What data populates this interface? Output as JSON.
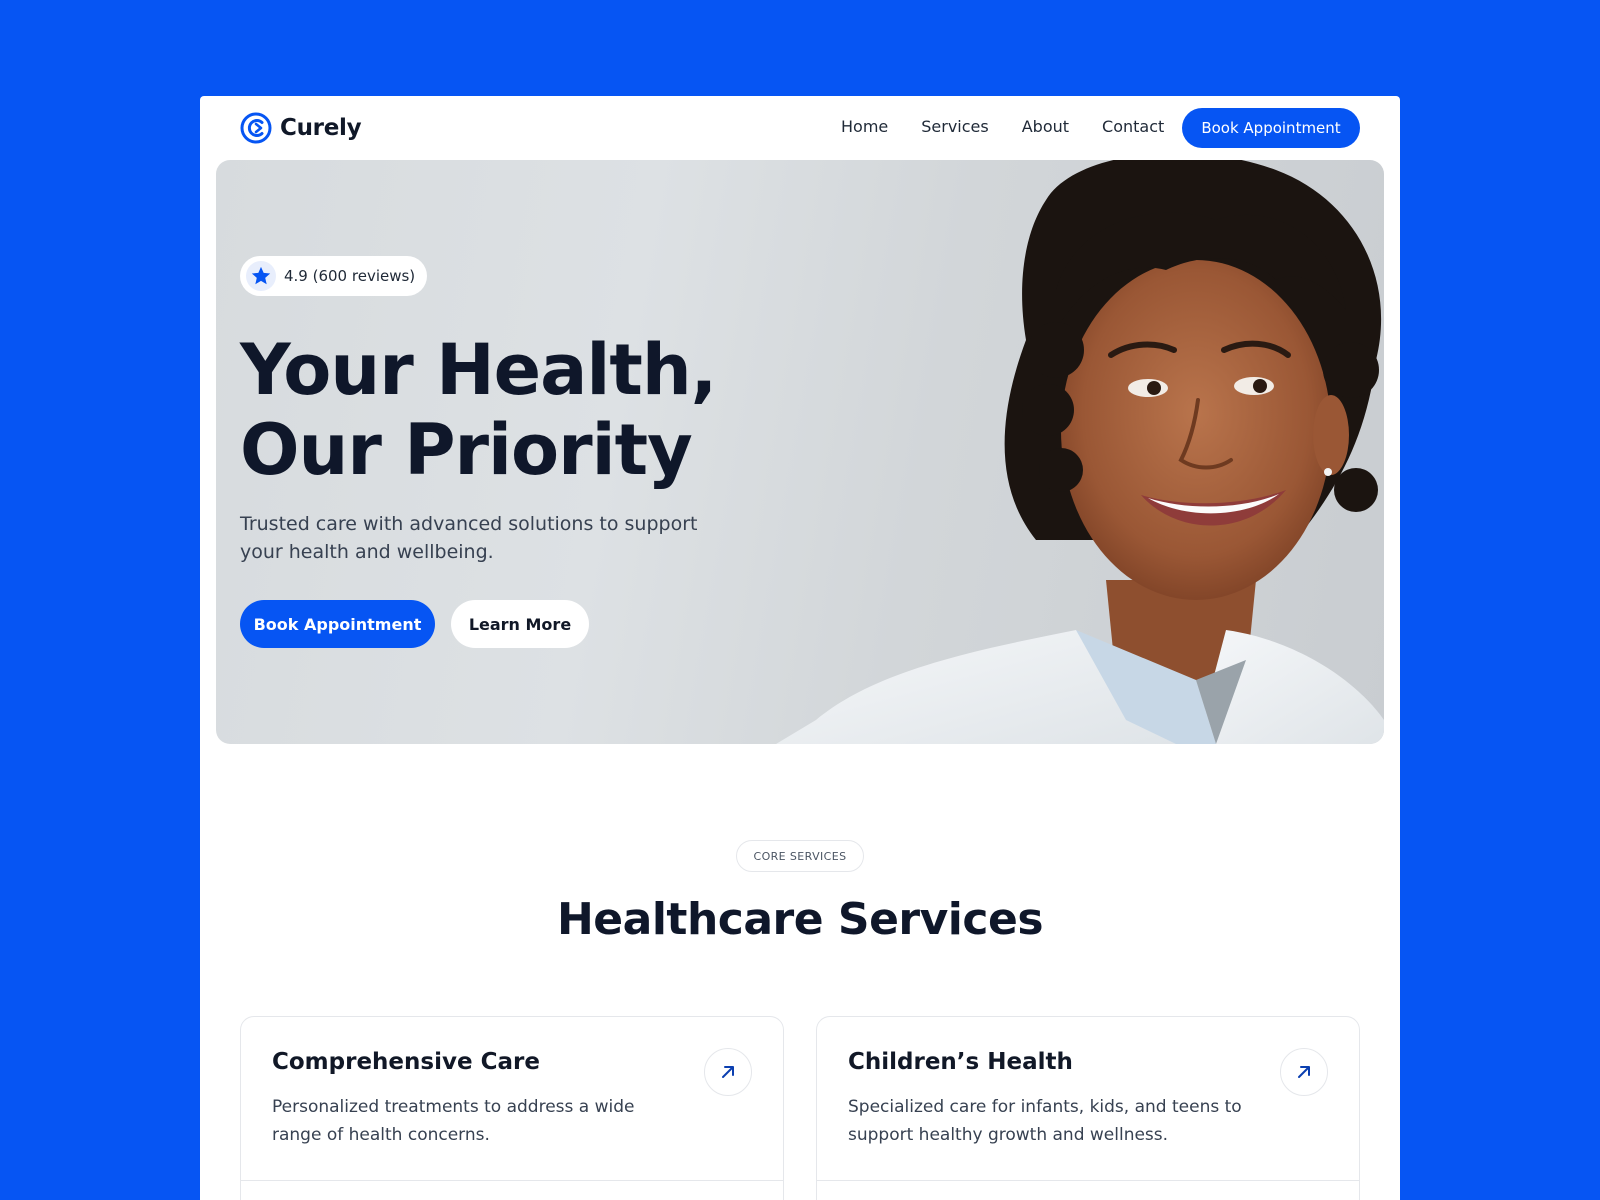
{
  "brand": {
    "name": "Curely",
    "accent": "#0655F3",
    "logo_icon": "curely-logo-icon"
  },
  "nav": {
    "links": [
      "Home",
      "Services",
      "About",
      "Contact"
    ],
    "cta_label": "Book Appointment"
  },
  "hero": {
    "rating_text": "4.9 (600 reviews)",
    "rating_icon": "star-icon",
    "title_line1": "Your Health,",
    "title_line2": "Our Priority",
    "subtitle": "Trusted care with advanced solutions to support your health and wellbeing.",
    "primary_label": "Book Appointment",
    "secondary_label": "Learn More",
    "image": "smiling-doctor-portrait"
  },
  "services": {
    "eyebrow": "CORE SERVICES",
    "title": "Healthcare Services",
    "cards": [
      {
        "title": "Comprehensive Care",
        "description": "Personalized treatments to address a wide range of health concerns.",
        "icon": "arrow-up-right-icon"
      },
      {
        "title": "Children’s Health",
        "description": "Specialized care for infants, kids, and teens to support healthy growth and wellness.",
        "icon": "arrow-up-right-icon"
      }
    ]
  }
}
